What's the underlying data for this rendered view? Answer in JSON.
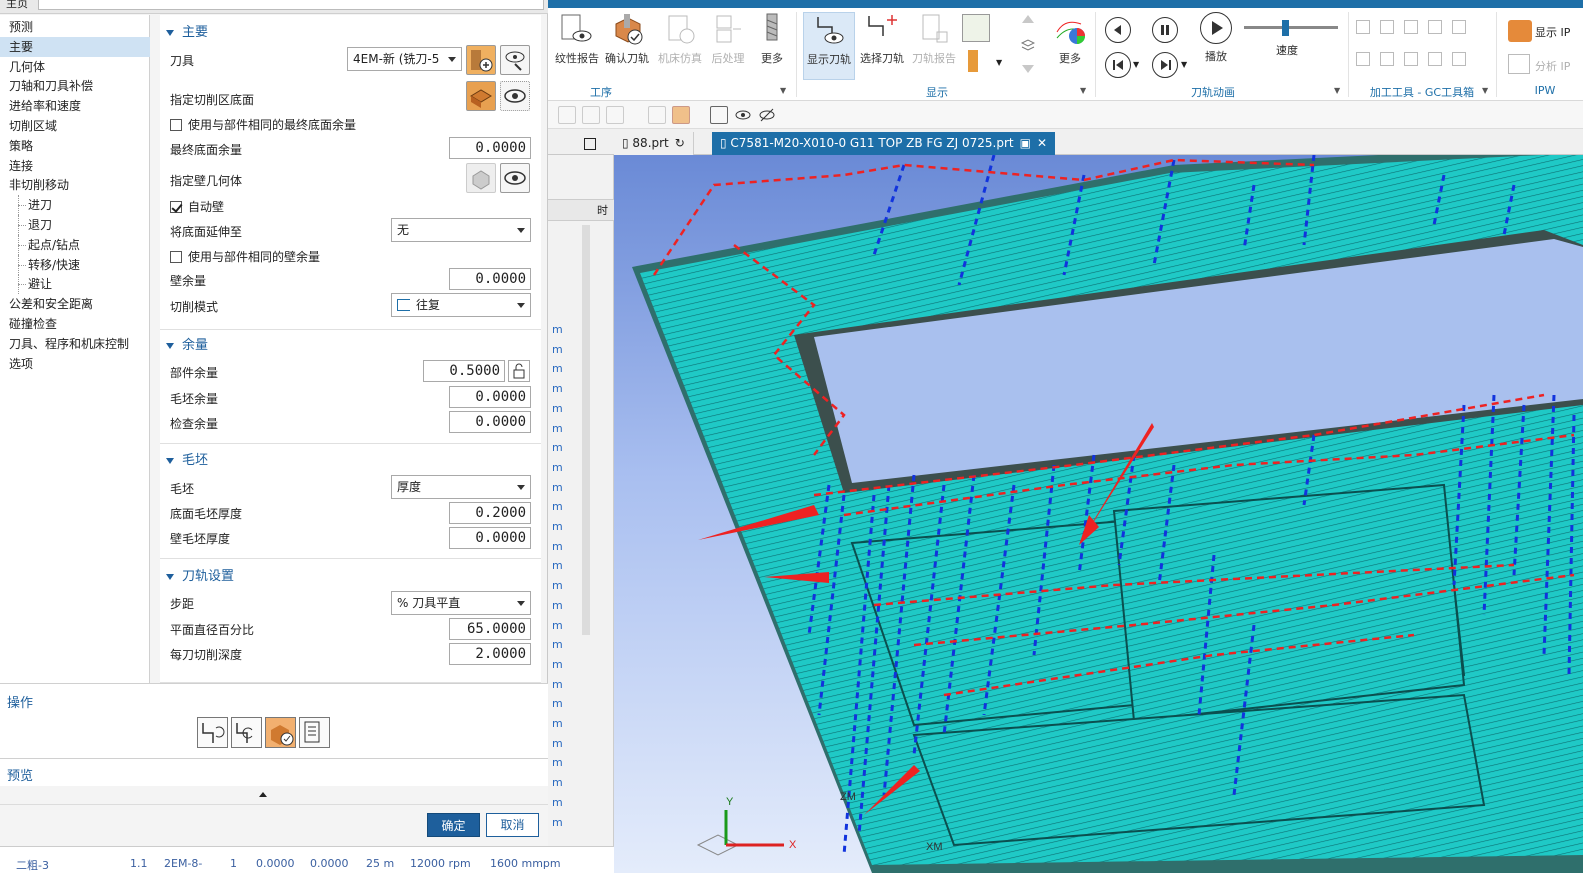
{
  "colors": {
    "accent": "#1e6fa8",
    "nav_selected": "#cfe2f3",
    "section_header": "#1e5f9c",
    "toolpath_blue": "#1133dd",
    "toolpath_red": "#ee2222",
    "part_cyan": "#22d4d0"
  },
  "dialog": {
    "title": "主页",
    "nav": [
      {
        "label": "预测",
        "level": "top",
        "selected": false
      },
      {
        "label": "主要",
        "level": "top",
        "selected": true
      },
      {
        "label": "几何体",
        "level": "top",
        "selected": false
      },
      {
        "label": "刀轴和刀具补偿",
        "level": "top",
        "selected": false
      },
      {
        "label": "进给率和速度",
        "level": "top",
        "selected": false
      },
      {
        "label": "切削区域",
        "level": "top",
        "selected": false
      },
      {
        "label": "策略",
        "level": "top",
        "selected": false
      },
      {
        "label": "连接",
        "level": "top",
        "selected": false
      },
      {
        "label": "非切削移动",
        "level": "top",
        "selected": false
      },
      {
        "label": "进刀",
        "level": "child",
        "selected": false
      },
      {
        "label": "退刀",
        "level": "child",
        "selected": false
      },
      {
        "label": "起点/钻点",
        "level": "child",
        "selected": false
      },
      {
        "label": "转移/快速",
        "level": "child",
        "selected": false
      },
      {
        "label": "避让",
        "level": "child",
        "selected": false
      },
      {
        "label": "公差和安全距离",
        "level": "top",
        "selected": false
      },
      {
        "label": "碰撞检查",
        "level": "top",
        "selected": false
      },
      {
        "label": "刀具、程序和机床控制",
        "level": "top",
        "selected": false
      },
      {
        "label": "选项",
        "level": "top",
        "selected": false
      }
    ],
    "main": {
      "header": "主要",
      "tool_label": "刀具",
      "tool_value": "4EM-新 (铣刀-5",
      "floor_label": "指定切削区底面",
      "same_floor_stock": "使用与部件相同的最终底面余量",
      "final_floor_stock_label": "最终底面余量",
      "final_floor_stock": "0.0000",
      "wall_geom_label": "指定壁几何体",
      "auto_wall": "自动壁",
      "extend_floor_label": "将底面延伸至",
      "extend_floor_value": "无",
      "same_wall_stock": "使用与部件相同的壁余量",
      "wall_stock_label": "壁余量",
      "wall_stock": "0.0000",
      "cut_pattern_label": "切削模式",
      "cut_pattern_value": "往复"
    },
    "stock": {
      "header": "余量",
      "part_stock_label": "部件余量",
      "part_stock": "0.5000",
      "blank_stock_label": "毛坯余量",
      "blank_stock": "0.0000",
      "check_stock_label": "检查余量",
      "check_stock": "0.0000"
    },
    "blank": {
      "header": "毛坯",
      "blank_label": "毛坯",
      "blank_value": "厚度",
      "floor_blank_label": "底面毛坯厚度",
      "floor_blank": "0.2000",
      "wall_blank_label": "壁毛坯厚度",
      "wall_blank": "0.0000"
    },
    "path": {
      "header": "刀轨设置",
      "stepover_label": "步距",
      "stepover_value": "% 刀具平直",
      "pct_label": "平面直径百分比",
      "pct_value": "65.0000",
      "depth_label": "每刀切削深度",
      "depth_value": "2.0000"
    },
    "operations_label": "操作",
    "preview_label": "预览",
    "ok": "确定",
    "cancel": "取消"
  },
  "ribbon": {
    "buttons": [
      {
        "label": "纹性报告",
        "disabled": false
      },
      {
        "label": "确认刀轨",
        "disabled": false
      },
      {
        "label": "机床仿真",
        "disabled": true
      },
      {
        "label": "后处理",
        "disabled": true
      },
      {
        "label": "更多",
        "disabled": false
      },
      {
        "label": "显示刀轨",
        "disabled": false
      },
      {
        "label": "选择刀轨",
        "disabled": false
      },
      {
        "label": "刀轨报告",
        "disabled": true
      },
      {
        "label": "更多",
        "disabled": false
      },
      {
        "label": "播放",
        "disabled": false
      },
      {
        "label": "速度",
        "disabled": false
      },
      {
        "label": "显示 IP",
        "disabled": false
      },
      {
        "label": "分析 IP",
        "disabled": true
      }
    ],
    "groups": [
      "工序",
      "显示",
      "刀轨动画",
      "加工工具 - GC工具箱",
      "IPW"
    ]
  },
  "tabs": [
    {
      "label": "88.prt",
      "active": false
    },
    {
      "label": "C7581-M20-X010-0 G11 TOP ZB FG ZJ 0725.prt",
      "active": true
    }
  ],
  "bg_column": {
    "header": "时",
    "rows": [
      "m",
      "m",
      "m",
      "m",
      "m",
      "m",
      "m",
      "m",
      "m",
      "m",
      "m",
      "m",
      "m",
      "m",
      "m",
      "m",
      "m",
      "m",
      "m",
      "m",
      "m",
      "m",
      "m",
      "m",
      "m",
      "m"
    ]
  },
  "bottom_table": {
    "cells": [
      "二粗-3",
      "1.1",
      "2EM-8-",
      "1",
      "0.0000",
      "0.0000",
      "25 m",
      "12000 rpm",
      "1600 mmpm"
    ]
  },
  "axis": {
    "y": "Y",
    "x": "X",
    "z": "ZM",
    "xm": "XM"
  }
}
